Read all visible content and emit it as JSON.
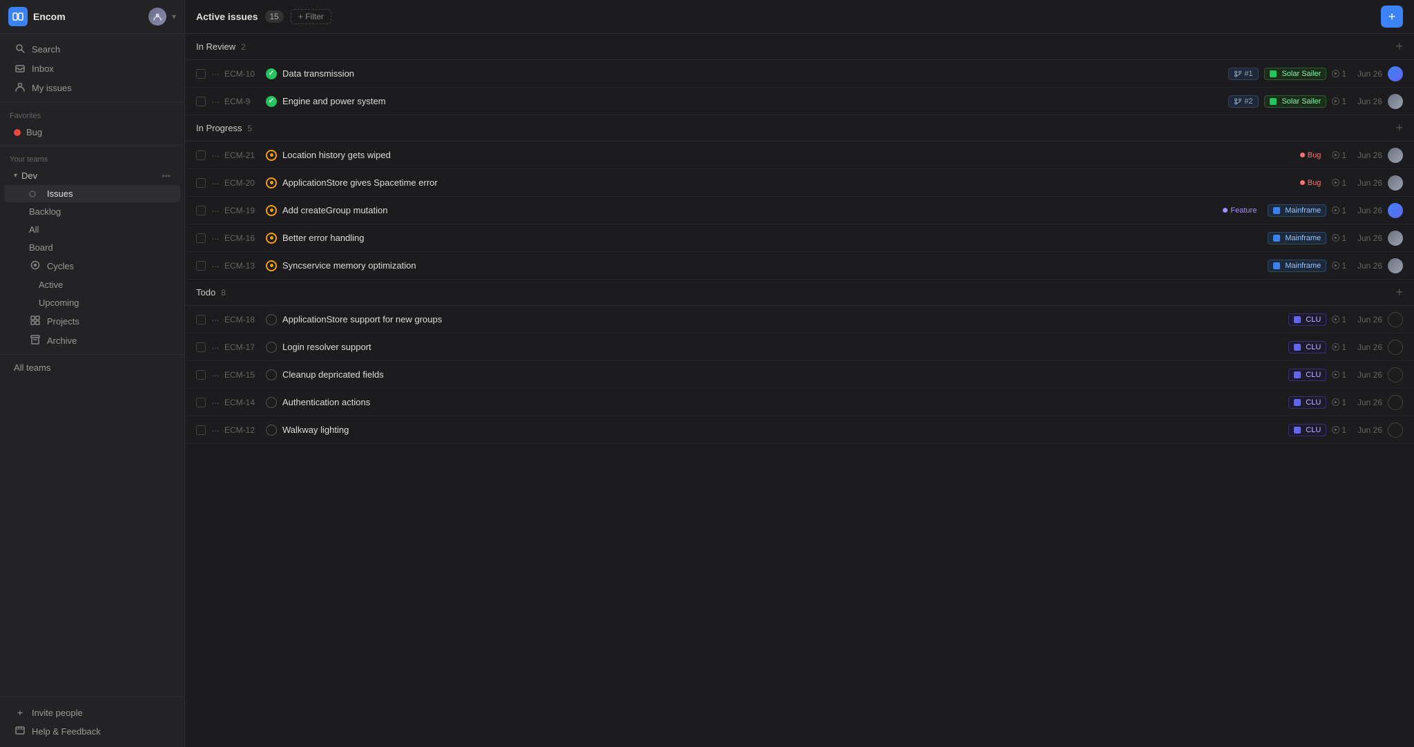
{
  "app": {
    "name": "Encom",
    "icon": "E"
  },
  "sidebar": {
    "search_label": "Search",
    "inbox_label": "Inbox",
    "my_issues_label": "My issues",
    "favorites_label": "Favorites",
    "bug_label": "Bug",
    "your_teams_label": "Your teams",
    "team_name": "Dev",
    "issues_label": "Issues",
    "backlog_label": "Backlog",
    "all_label": "All",
    "board_label": "Board",
    "cycles_label": "Cycles",
    "active_label": "Active",
    "upcoming_label": "Upcoming",
    "projects_label": "Projects",
    "archive_label": "Archive",
    "all_teams_label": "All teams",
    "invite_label": "Invite people",
    "help_label": "Help & Feedback"
  },
  "main": {
    "title": "Active issues",
    "count": "15",
    "filter_label": "+ Filter",
    "add_icon": "+"
  },
  "groups": [
    {
      "name": "In Review",
      "count": "2",
      "issues": [
        {
          "id": "ECM-10",
          "title": "Data transmission",
          "status": "green",
          "pr_num": "#1",
          "project": "Solar Sailer",
          "project_color": "green",
          "play_count": "1",
          "date": "Jun 26",
          "has_avatar": true,
          "avatar_type": "gradient-blue"
        },
        {
          "id": "ECM-9",
          "title": "Engine and power system",
          "status": "green",
          "pr_num": "#2",
          "project": "Solar Sailer",
          "project_color": "green",
          "play_count": "1",
          "date": "Jun 26",
          "has_avatar": true,
          "avatar_type": "gradient-gray"
        }
      ]
    },
    {
      "name": "In Progress",
      "count": "5",
      "issues": [
        {
          "id": "ECM-21",
          "title": "Location history gets wiped",
          "status": "orange",
          "label": "Bug",
          "label_color": "#f87171",
          "play_count": "1",
          "date": "Jun 26",
          "has_avatar": true,
          "avatar_type": "gradient-gray"
        },
        {
          "id": "ECM-20",
          "title": "ApplicationStore gives Spacetime error",
          "status": "orange",
          "label": "Bug",
          "label_color": "#f87171",
          "play_count": "1",
          "date": "Jun 26",
          "has_avatar": true,
          "avatar_type": "gradient-gray"
        },
        {
          "id": "ECM-19",
          "title": "Add createGroup mutation",
          "status": "orange",
          "label": "Feature",
          "label_color": "#a78bfa",
          "project": "Mainframe",
          "project_color": "blue",
          "play_count": "1",
          "date": "Jun 26",
          "has_avatar": true,
          "avatar_type": "gradient-blue"
        },
        {
          "id": "ECM-16",
          "title": "Better error handling",
          "status": "orange",
          "project": "Mainframe",
          "project_color": "blue",
          "play_count": "1",
          "date": "Jun 26",
          "has_avatar": true,
          "avatar_type": "gradient-gray"
        },
        {
          "id": "ECM-13",
          "title": "Syncservice memory optimization",
          "status": "orange",
          "project": "Mainframe",
          "project_color": "blue",
          "play_count": "1",
          "date": "Jun 26",
          "has_avatar": true,
          "avatar_type": "gradient-gray"
        }
      ]
    },
    {
      "name": "Todo",
      "count": "8",
      "issues": [
        {
          "id": "ECM-18",
          "title": "ApplicationStore support for new groups",
          "status": "empty",
          "project": "CLU",
          "project_color": "purple",
          "play_count": "1",
          "date": "Jun 26",
          "has_avatar": true,
          "avatar_type": "empty"
        },
        {
          "id": "ECM-17",
          "title": "Login resolver support",
          "status": "empty",
          "project": "CLU",
          "project_color": "purple",
          "play_count": "1",
          "date": "Jun 26",
          "has_avatar": true,
          "avatar_type": "empty"
        },
        {
          "id": "ECM-15",
          "title": "Cleanup depricated fields",
          "status": "empty",
          "project": "CLU",
          "project_color": "purple",
          "play_count": "1",
          "date": "Jun 26",
          "has_avatar": true,
          "avatar_type": "empty"
        },
        {
          "id": "ECM-14",
          "title": "Authentication actions",
          "status": "empty",
          "project": "CLU",
          "project_color": "purple",
          "play_count": "1",
          "date": "Jun 26",
          "has_avatar": true,
          "avatar_type": "empty"
        },
        {
          "id": "ECM-12",
          "title": "Walkway lighting",
          "status": "empty",
          "project": "CLU",
          "project_color": "purple",
          "play_count": "1",
          "date": "Jun 26",
          "has_avatar": true,
          "avatar_type": "empty"
        }
      ]
    }
  ],
  "colors": {
    "accent_blue": "#3b82f6",
    "status_green": "#22c55e",
    "status_orange": "#f59e0b",
    "tag_bug": "#f87171",
    "tag_feature": "#a78bfa",
    "tag_solar_sailer": "#22c55e",
    "tag_mainframe": "#3b82f6",
    "tag_clu": "#6366f1"
  }
}
